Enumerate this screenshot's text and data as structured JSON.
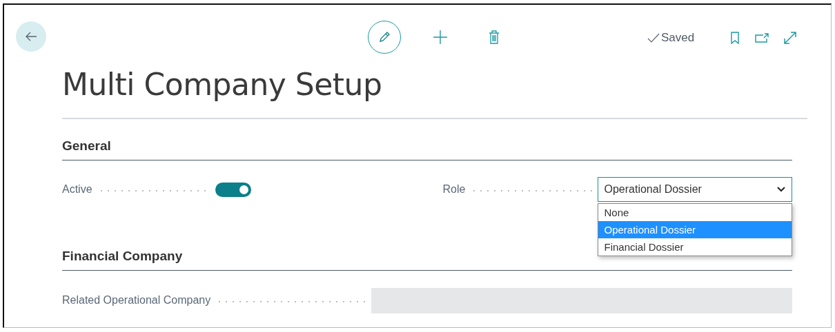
{
  "page": {
    "title": "Multi Company Setup",
    "status": "Saved"
  },
  "sections": [
    {
      "title": "General",
      "fields": [
        {
          "kind": "toggle",
          "label": "Active",
          "on": true
        },
        {
          "kind": "select",
          "label": "Role",
          "value": "Operational Dossier",
          "expanded": true,
          "options": [
            {
              "label": "None",
              "selected": false
            },
            {
              "label": "Operational Dossier",
              "selected": true
            },
            {
              "label": "Financial Dossier",
              "selected": false
            }
          ]
        }
      ]
    },
    {
      "title": "Financial Company",
      "fields": [
        {
          "kind": "text",
          "label": "Related Operational Company",
          "disabled": true
        }
      ]
    }
  ]
}
